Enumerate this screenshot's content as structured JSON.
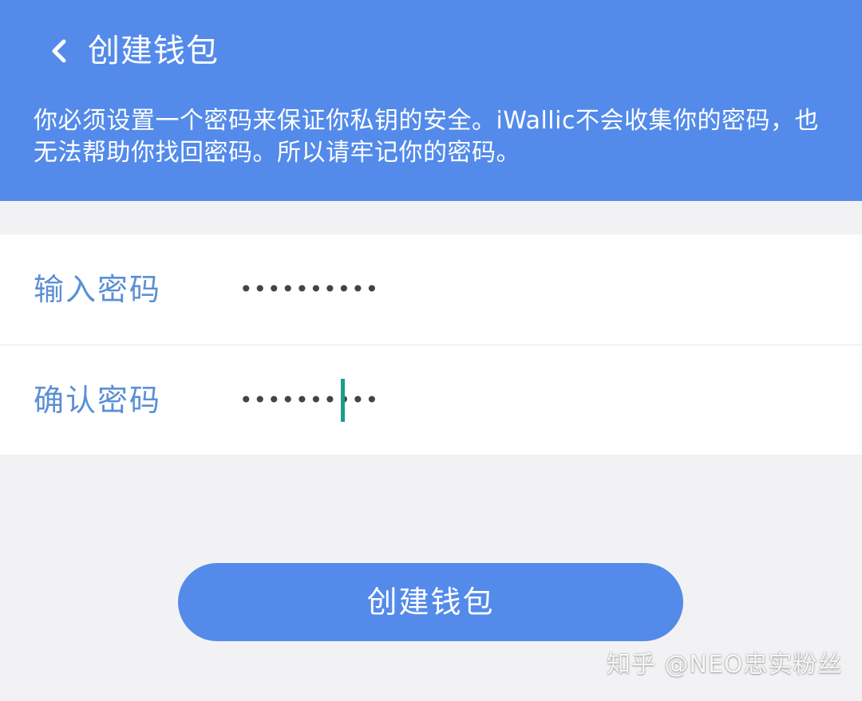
{
  "header": {
    "back_icon": "chevron-left-icon",
    "title": "创建钱包",
    "description": "你必须设置一个密码来保证你私钥的安全。iWallic不会收集你的密码，也无法帮助你找回密码。所以请牢记你的密码。"
  },
  "form": {
    "password": {
      "label": "输入密码",
      "value": "••••••••••"
    },
    "confirm_password": {
      "label": "确认密码",
      "value": "••••••••••"
    }
  },
  "create_button": {
    "label": "创建钱包"
  },
  "watermark": {
    "text": "知乎 @NEO忠实粉丝"
  },
  "colors": {
    "primary": "#548bea",
    "label": "#5b8fd6",
    "caret": "#1a9e8a",
    "background": "#f2f2f4"
  }
}
